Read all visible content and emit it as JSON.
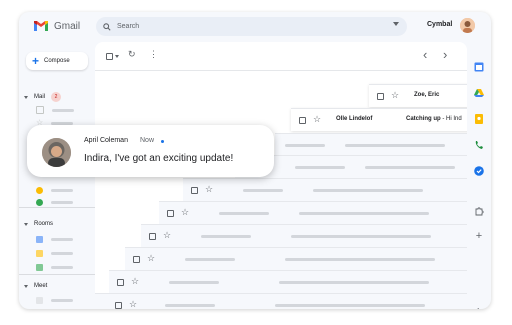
{
  "app": {
    "name": "Gmail",
    "brand": "Cymbal",
    "colors": {
      "red": "#ea4335",
      "blue": "#4285f4",
      "green": "#34a853",
      "yellow": "#fbbc04"
    }
  },
  "search": {
    "placeholder": "Search"
  },
  "sidebar": {
    "compose_label": "Compose",
    "mail_label": "Mail",
    "mail_count": "2",
    "rooms_label": "Rooms",
    "meet_label": "Meet"
  },
  "toolbar": {
    "refresh_icon": "refresh-icon",
    "more_icon": "more-vert-icon",
    "prev_icon": "chevron-left-icon",
    "next_icon": "chevron-right-icon"
  },
  "emails": [
    {
      "sender": "Zoe, Eric",
      "subject": ""
    },
    {
      "sender": "Olle Lindelof",
      "subject": "Catching up",
      "snippet": " - Hi Ind"
    }
  ],
  "notification": {
    "sender": "April Coleman",
    "time": "Now",
    "message": "Indira, I've got an exciting update!"
  },
  "rail": [
    "calendar-icon",
    "drive-icon",
    "keep-icon",
    "contacts-icon",
    "tasks-icon",
    "addons-icon",
    "add-icon",
    "expand-icon"
  ]
}
